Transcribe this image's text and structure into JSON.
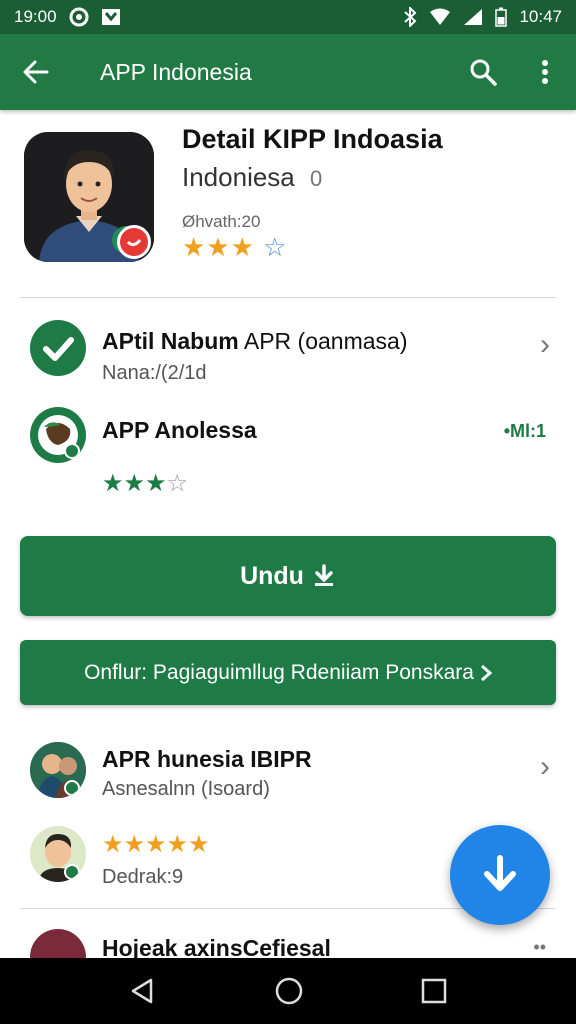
{
  "status_bar": {
    "time_left": "19:00",
    "time_right": "10:47"
  },
  "app_bar": {
    "title": "APP Indonesia",
    "back_icon": "arrow-left-icon",
    "search_icon": "search-icon",
    "menu_icon": "more-vert-icon"
  },
  "header": {
    "name": "Detail KIPP Indoasia",
    "developer": "Indoniesa",
    "developer_suffix": "0",
    "meta": "Øhvath:20",
    "rating_stars": "★★★",
    "rating_empty": "☆"
  },
  "rows": [
    {
      "title": "APtil Nabum",
      "title_rest": " APR (oanmasa)",
      "sub": "Nana:/(2/1d"
    },
    {
      "title": "APP Anolessa",
      "right": "•Ml:1",
      "rating_filled": "★★★",
      "rating_empty": "☆"
    }
  ],
  "primary_button": {
    "label": "Undu"
  },
  "secondary_button": {
    "label": "Onflur: Pagiaguimllug Rdeniiam Ponskara"
  },
  "lower_rows": [
    {
      "title": "APR hunesia IBIPR",
      "sub": "Asnesalnn (Isoard)"
    },
    {
      "rating": "★★★★★",
      "sub": "Dedrak:9"
    },
    {
      "title": "Hojeak axinsCefiesal"
    }
  ],
  "colors": {
    "app_bar": "#217a43",
    "status_bar": "#1b5e33",
    "button": "#1e7b45",
    "fab": "#2185e8",
    "star": "#f0a020"
  }
}
